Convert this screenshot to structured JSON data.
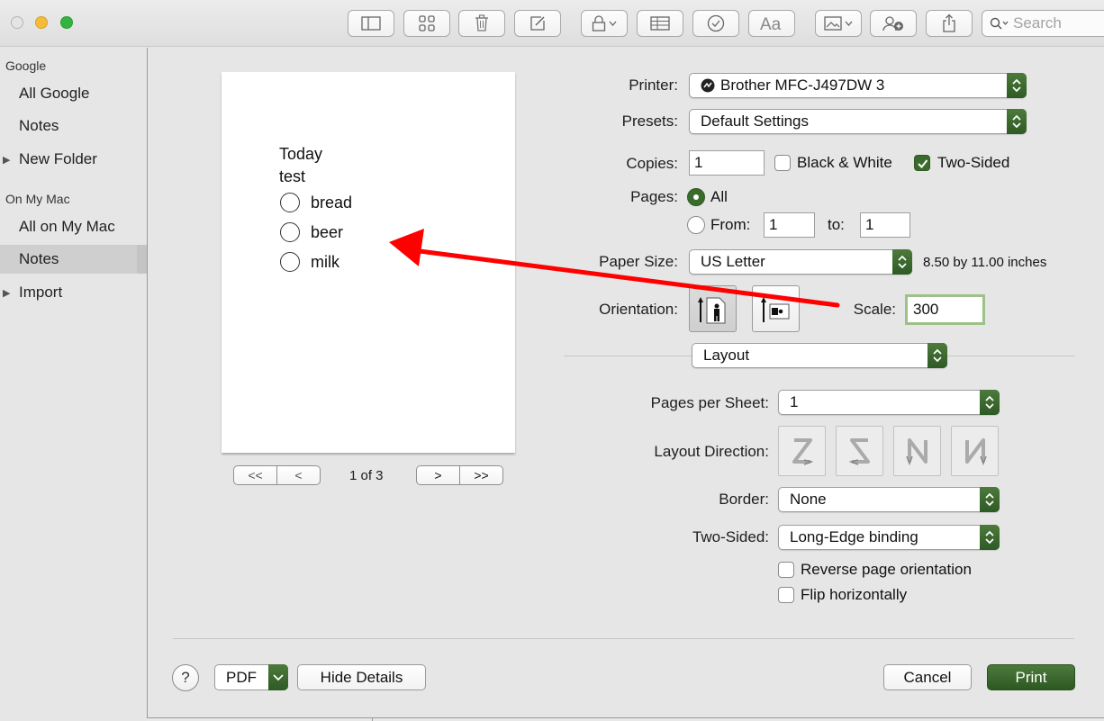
{
  "toolbar": {
    "search_placeholder": "Search"
  },
  "sidebar": {
    "section_google": "Google",
    "google_items": [
      "All Google",
      "Notes",
      "New Folder"
    ],
    "section_mac": "On My Mac",
    "mac_items": [
      "All on My Mac",
      "Notes",
      "Import"
    ]
  },
  "preview": {
    "title": "Today",
    "subtitle": "test",
    "checklist": [
      "bread",
      "beer",
      "milk"
    ],
    "page_indicator": "1 of 3",
    "nav_first": "<<",
    "nav_prev": "<",
    "nav_next": ">",
    "nav_last": ">>"
  },
  "print": {
    "printer_label": "Printer:",
    "printer_value": "Brother MFC-J497DW 3",
    "presets_label": "Presets:",
    "presets_value": "Default Settings",
    "copies_label": "Copies:",
    "copies_value": "1",
    "black_white_label": "Black & White",
    "black_white_checked": false,
    "two_sided_label": "Two-Sided",
    "two_sided_checked": true,
    "pages_label": "Pages:",
    "pages_all_label": "All",
    "pages_from_label": "From:",
    "pages_from_value": "1",
    "pages_to_label": "to:",
    "pages_to_value": "1",
    "paper_size_label": "Paper Size:",
    "paper_size_value": "US Letter",
    "paper_size_dims": "8.50 by 11.00 inches",
    "orientation_label": "Orientation:",
    "scale_label": "Scale:",
    "scale_value": "300",
    "section_value": "Layout",
    "pages_per_sheet_label": "Pages per Sheet:",
    "pages_per_sheet_value": "1",
    "layout_direction_label": "Layout Direction:",
    "border_label": "Border:",
    "border_value": "None",
    "two_sided_binding_label": "Two-Sided:",
    "two_sided_binding_value": "Long-Edge binding",
    "reverse_orientation_label": "Reverse page orientation",
    "flip_horizontally_label": "Flip horizontally"
  },
  "buttons": {
    "help": "?",
    "pdf": "PDF",
    "hide_details": "Hide Details",
    "cancel": "Cancel",
    "print": "Print"
  },
  "colors": {
    "accent": "#3b6b2c",
    "annotation_arrow": "#ff0000"
  }
}
